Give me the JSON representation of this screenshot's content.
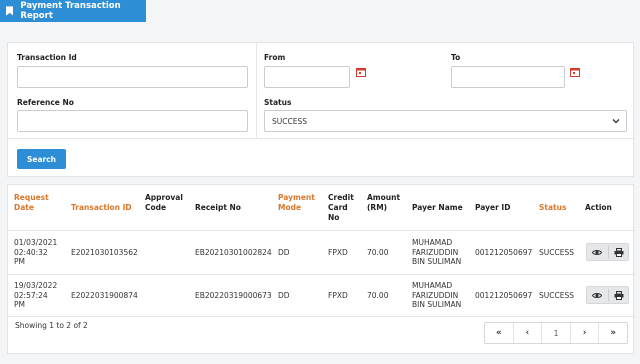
{
  "header": {
    "tab_label": "Payment Transaction Report"
  },
  "filters": {
    "transaction_id_label": "Transaction Id",
    "transaction_id_value": "",
    "reference_no_label": "Reference No",
    "reference_no_value": "",
    "from_label": "From",
    "from_value": "",
    "to_label": "To",
    "to_value": "",
    "status_label": "Status",
    "status_value": "SUCCESS",
    "search_label": "Search"
  },
  "table": {
    "columns": {
      "request_date": [
        "Request",
        "Date"
      ],
      "transaction_id": "Transaction ID",
      "approval_code": [
        "Approval",
        "Code"
      ],
      "receipt_no": "Receipt No",
      "payment_mode": [
        "Payment",
        "Mode"
      ],
      "credit_card_no": [
        "Credit",
        "Card",
        "No"
      ],
      "amount": [
        "Amount",
        "(RM)"
      ],
      "payer_name": "Payer Name",
      "payer_id": "Payer ID",
      "status": "Status",
      "action": "Action"
    },
    "rows": [
      {
        "date": [
          "01/03/2021",
          "02:40:32",
          "PM"
        ],
        "transaction_id": "E2021030103562",
        "approval_code": "",
        "receipt_no": "EB20210301002824",
        "payment_mode": "DD",
        "credit_card_no": "FPXD",
        "amount": "70.00",
        "payer_name": [
          "MUHAMAD",
          "FARIZUDDIN",
          "BIN SULIMAN"
        ],
        "payer_id": "001212050697",
        "status": "SUCCESS"
      },
      {
        "date": [
          "19/03/2022",
          "02:57:24",
          "PM"
        ],
        "transaction_id": "E2022031900874",
        "approval_code": "",
        "receipt_no": "EB20220319000673",
        "payment_mode": "DD",
        "credit_card_no": "FPXD",
        "amount": "70.00",
        "payer_name": [
          "MUHAMAD",
          "FARIZUDDIN",
          "BIN SULIMAN"
        ],
        "payer_id": "001212050697",
        "status": "SUCCESS"
      }
    ]
  },
  "footer": {
    "showing_text": "Showing 1 to 2 of 2",
    "pagination": {
      "first": "«",
      "prev": "‹",
      "page": "1",
      "next": "›",
      "last": "»"
    }
  },
  "colors": {
    "primary": "#2d8ed6",
    "sort_header": "#d9772b"
  },
  "icons": {
    "tab": "bookmark-icon",
    "date": "calendar-icon",
    "view": "eye-icon",
    "print": "printer-icon",
    "select": "chevron-down-icon"
  }
}
